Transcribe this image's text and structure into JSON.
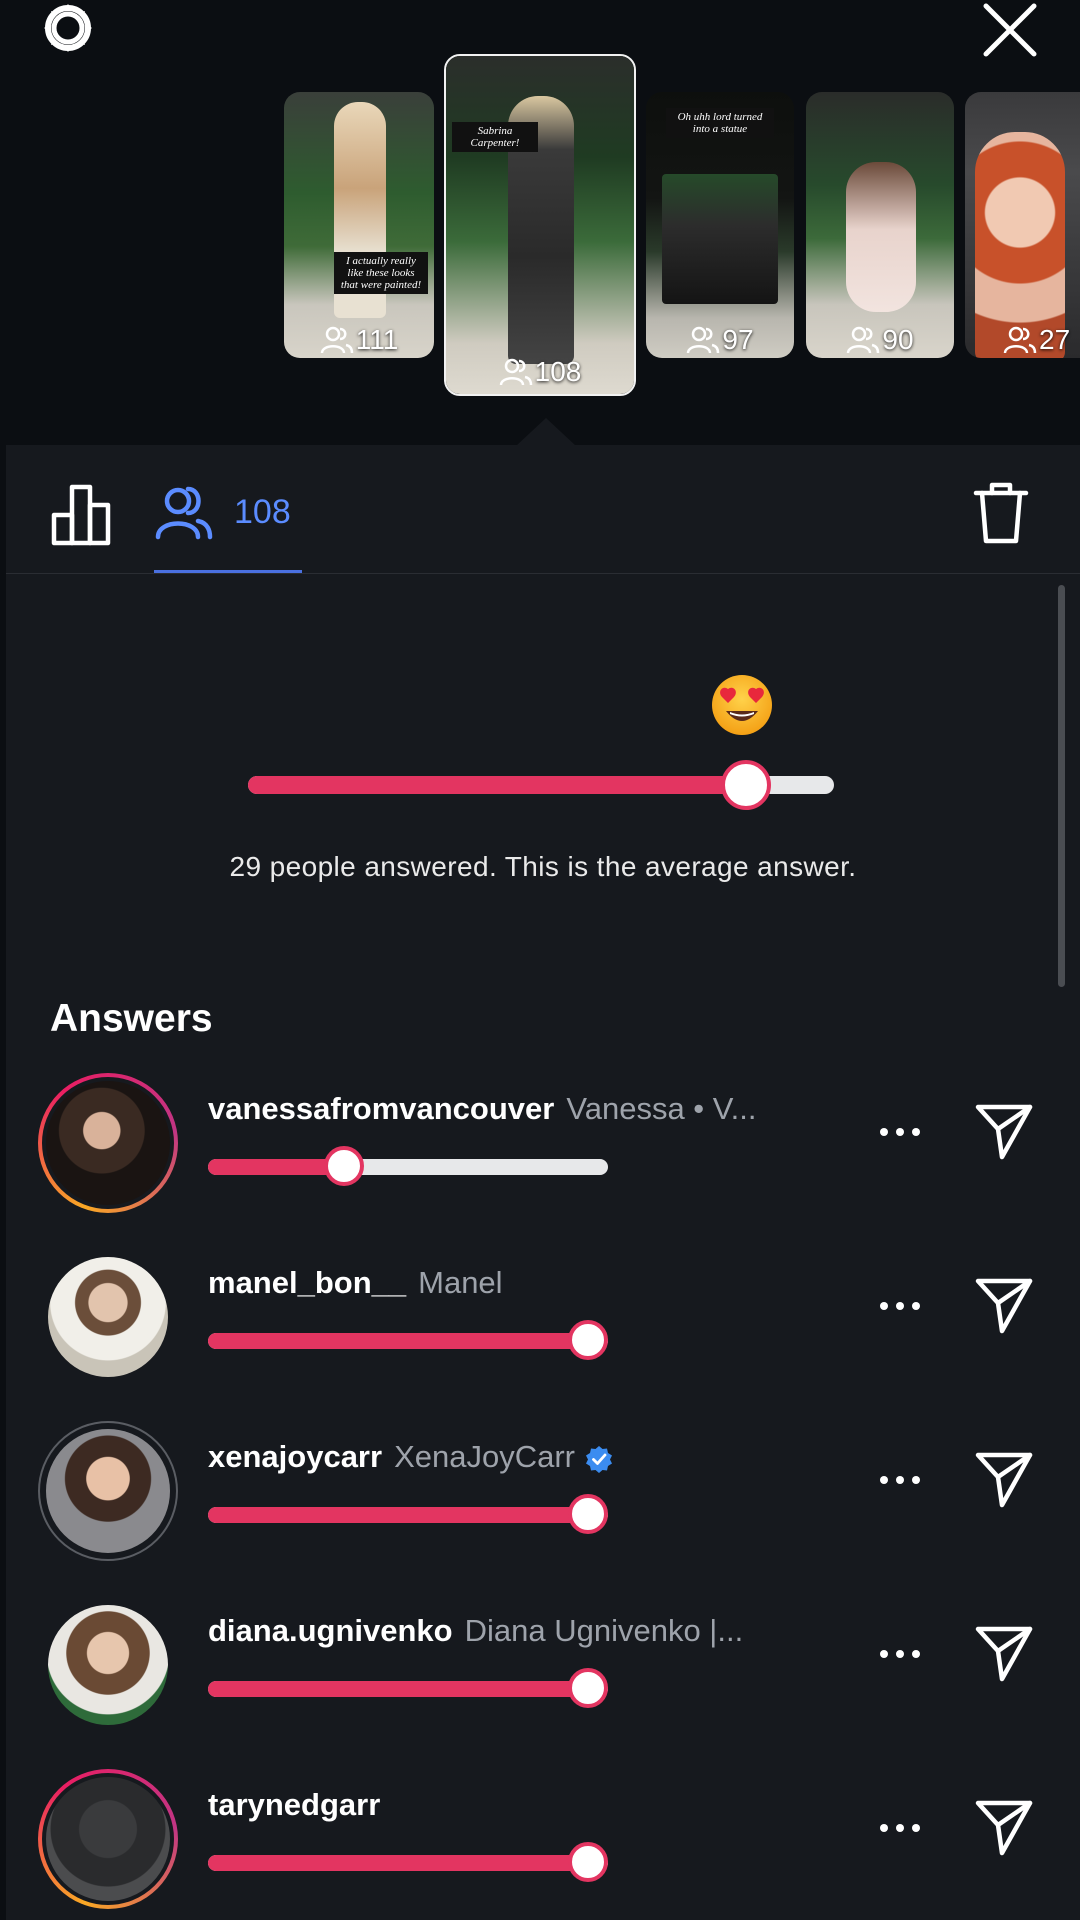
{
  "stories": [
    {
      "viewers": "111",
      "overlay": "I actually really like these looks that were painted!"
    },
    {
      "viewers": "108",
      "overlay": "Sabrina Carpenter!"
    },
    {
      "viewers": "97",
      "overlay": "Oh uhh lord turned into a statue"
    },
    {
      "viewers": "90",
      "overlay": ""
    },
    {
      "viewers": "27",
      "overlay": ""
    }
  ],
  "tabs": {
    "viewers_count": "108"
  },
  "average": {
    "caption": "29 people answered. This is the average answer.",
    "value": 0.85,
    "emoji": "heart-eyes-emoji"
  },
  "answers": {
    "title": "Answers",
    "items": [
      {
        "username": "vanessafromvancouver",
        "fullname": "Vanessa • V...",
        "value": 0.34,
        "ring": "story",
        "verified": false
      },
      {
        "username": "manel_bon__",
        "fullname": "Manel",
        "value": 0.95,
        "ring": "none",
        "verified": false
      },
      {
        "username": "xenajoycarr",
        "fullname": "XenaJoyCarr",
        "value": 0.95,
        "ring": "close",
        "verified": true
      },
      {
        "username": "diana.ugnivenko",
        "fullname": "Diana Ugnivenko |...",
        "value": 0.95,
        "ring": "none",
        "verified": false
      },
      {
        "username": "tarynedgarr",
        "fullname": "",
        "value": 0.95,
        "ring": "story",
        "verified": false
      }
    ]
  },
  "colors": {
    "accent": "#e33561",
    "link": "#5b8cff",
    "background": "#16191e"
  }
}
